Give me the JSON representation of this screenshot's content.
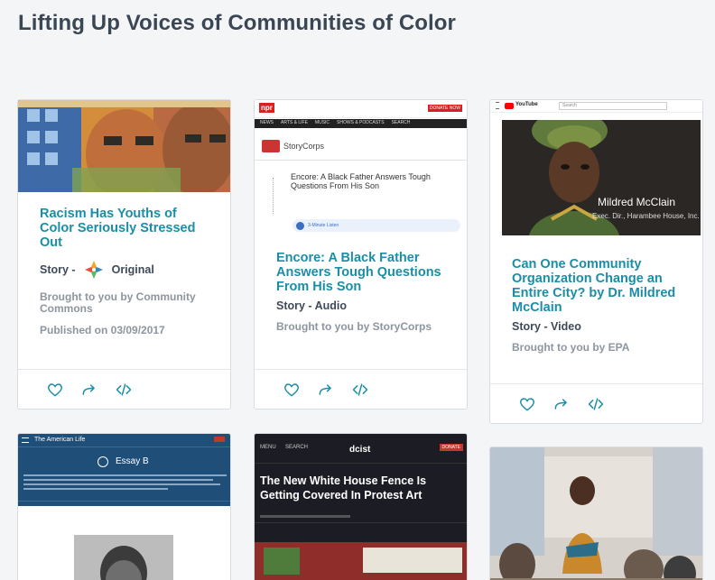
{
  "page": {
    "title": "Lifting Up Voices of Communities of Color"
  },
  "cards": [
    {
      "title": "Racism Has Youths of Color Seriously Stressed Out",
      "type": "Story - ",
      "badge": "Original",
      "brought": "Brought to you by Community Commons",
      "published": "Published on 03/09/2017"
    },
    {
      "title": "Encore: A Black Father Answers Tough Questions From His Son",
      "type": "Story - Audio",
      "brought": "Brought to you by StoryCorps",
      "thumb": {
        "logo": "npr",
        "nav": [
          "NEWS",
          "ARTS & LIFE",
          "MUSIC",
          "SHOWS & PODCASTS",
          "SEARCH"
        ],
        "donate": "DONATE NOW",
        "brand": "StoryCorps",
        "headline": "Encore: A Black Father Answers Tough Questions From His Son",
        "listen": "3-Minute Listen"
      }
    },
    {
      "title": "Can One Community Organization Change an Entire City? by Dr. Mildred McClain",
      "type": "Story - Video",
      "brought": "Brought to you by EPA",
      "thumb": {
        "site": "YouTube",
        "search": "Search",
        "name": "Mildred McClain",
        "org": "Exec. Dir., Harambee House, Inc."
      }
    },
    {
      "thumb": {
        "site": "The American Life",
        "heading": "Essay B"
      }
    },
    {
      "thumb": {
        "site": "dcist",
        "menu": "MENU",
        "search": "SEARCH",
        "donate": "DONATE",
        "headline": "The New White House Fence Is Getting Covered In Protest Art"
      }
    },
    {
      "thumb": {}
    }
  ],
  "colors": {
    "accent": "#1a8ea6",
    "title": "#3a4654",
    "muted": "#8d959e",
    "npr_red": "#d62021",
    "youtube_red": "#ff0000"
  },
  "icons": [
    "heart-icon",
    "share-icon",
    "embed-icon",
    "play-icon"
  ]
}
